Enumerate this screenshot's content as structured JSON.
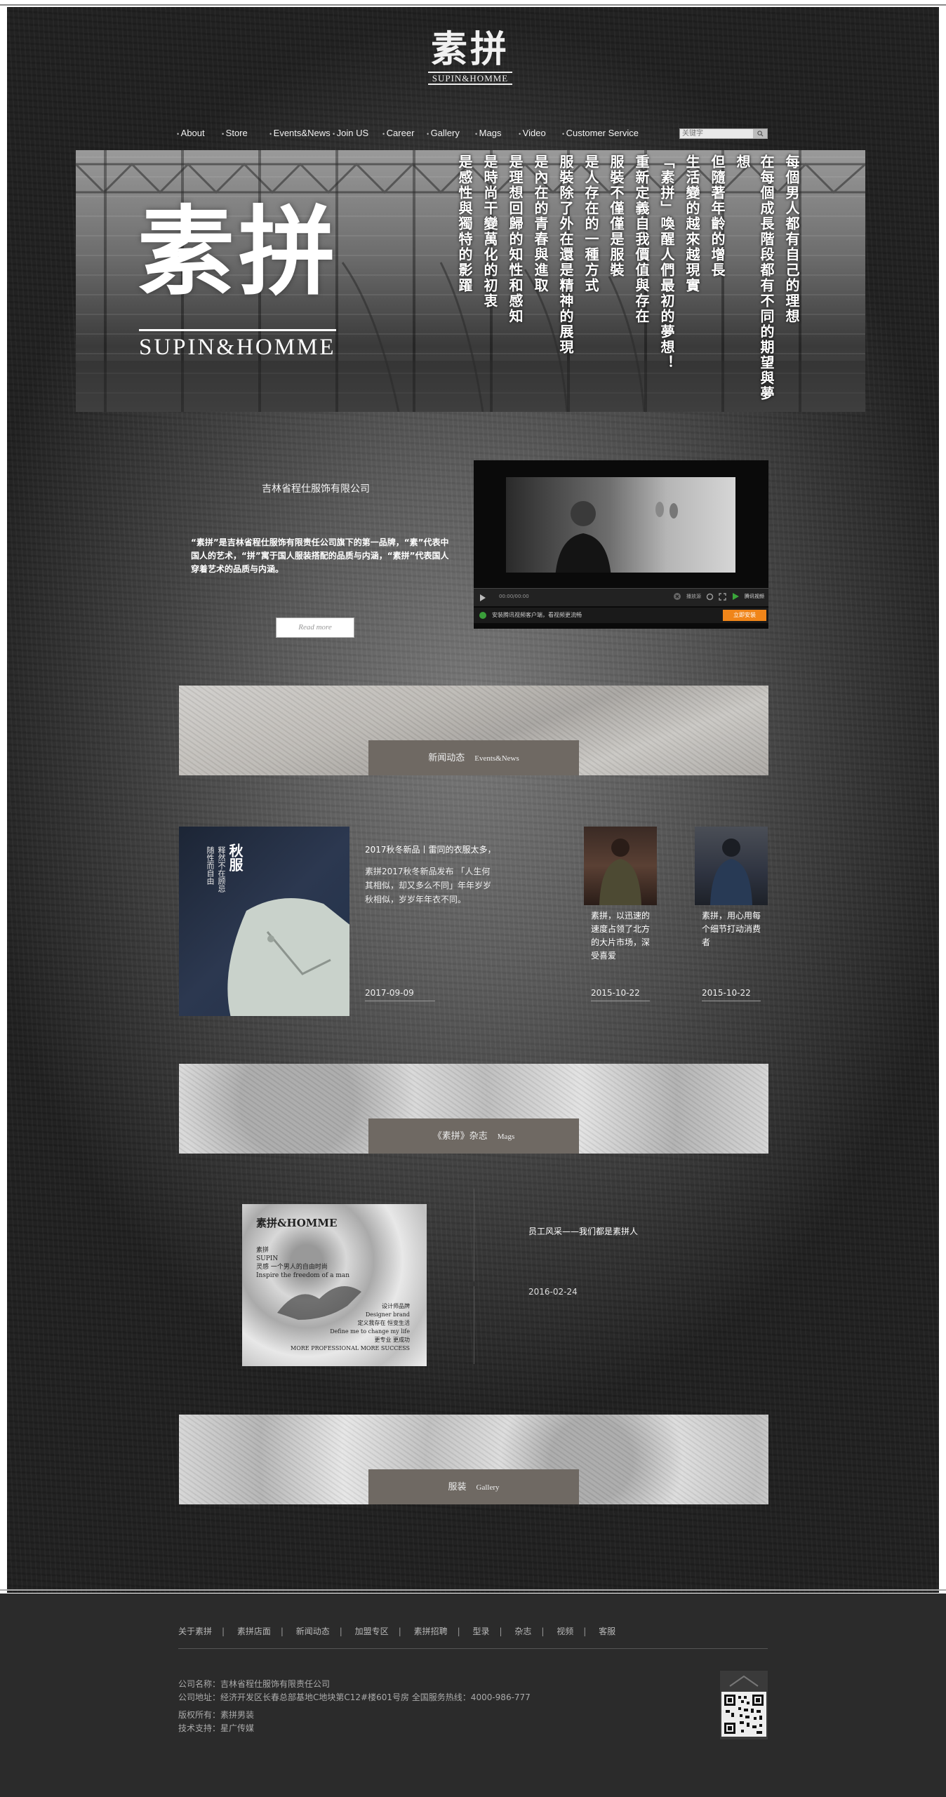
{
  "logo": {
    "cn": "素拼",
    "en": "SUPIN&HOMME"
  },
  "nav": {
    "items": [
      "About",
      "Store",
      "Events&News",
      "Join US",
      "Career",
      "Gallery",
      "Mags",
      "Video",
      "Customer Service"
    ],
    "search_placeholder": "关键字"
  },
  "banner": {
    "big_cn": "素拼",
    "big_en": "SUPIN&HOMME",
    "poem": [
      "每個男人都有自己的理想",
      "在每個成長階段都有不同的期望與夢想",
      "但隨著年齡的增長",
      "生活變的越來越現實",
      "「素拼」喚醒人們最初的夢想！",
      "重新定義自我價值與存在",
      "服裝不僅僅是服裝",
      "是人存在的一種方式",
      "服裝除了外在還是精神的展現",
      "是內在的青春與進取",
      "是理想回歸的知性和感知",
      "是時尚干變萬化的初衷",
      "是感性與獨特的影躍"
    ]
  },
  "intro": {
    "company": "吉林省程仕服饰有限公司",
    "text": "“素拼”是吉林省程仕服饰有限责任公司旗下的第一品牌，“素”代表中国人的艺术，“拼”寓于国人服装搭配的品质与内涵，“素拼”代表国人穿着艺术的品质与内涵。",
    "read_more": "Read more"
  },
  "video": {
    "time": "00:00/00:00",
    "hd_label": "播放源",
    "brand_label": "腾讯视频",
    "promo": "安装腾讯视频客户端，看视频更流畅",
    "install": "立即安装"
  },
  "sections": {
    "news": {
      "cn": "新闻动态",
      "en": "Events&News"
    },
    "mags": {
      "cn": "《素拼》杂志",
      "en": "Mags"
    },
    "gallery": {
      "cn": "服装",
      "en": "Gallery"
    }
  },
  "news": {
    "main": {
      "img_text_large": "秋服",
      "img_text_small": [
        "释然不在顾忌",
        "随性而自由"
      ],
      "title": "2017秋冬新品丨雷同的衣服太多，",
      "desc": "素拼2017秋冬新品发布 「人生何其相似，却又多么不同」年年岁岁秋相似，岁岁年年衣不同。",
      "date": "2017-09-09"
    },
    "items": [
      {
        "caption": "素拼，以迅速的速度占领了北方的大片市场，深受喜爱",
        "date": "2015-10-22"
      },
      {
        "caption": "素拼，用心用每个细节打动消费者",
        "date": "2015-10-22"
      }
    ]
  },
  "mag": {
    "img_header": "素拼&HOMME",
    "img_lines": [
      "素拼",
      "SUPIN",
      "灵感 一个男人的自由时尚",
      "Inspire the freedom of a man",
      "设计师品牌",
      "Designer brand",
      "定义我存在 恒变生活",
      "Define me to change my life",
      "更专业 更成功",
      "MORE PROFESSIONAL MORE SUCCESS"
    ],
    "title": "员工风采——我们都是素拼人",
    "date": "2016-02-24"
  },
  "footer": {
    "links": [
      "关于素拼",
      "素拼店面",
      "新闻动态",
      "加盟专区",
      "素拼招聘",
      "型录",
      "杂志",
      "视频",
      "客服"
    ],
    "company_name": "公司名称：吉林省程仕服饰有限责任公司",
    "address": "公司地址：经济开发区长春总部基地C地块第C12#楼601号房    全国服务热线：4000-986-777",
    "copyright": "版权所有：素拼男装",
    "support": "技术支持：星广传媒"
  }
}
